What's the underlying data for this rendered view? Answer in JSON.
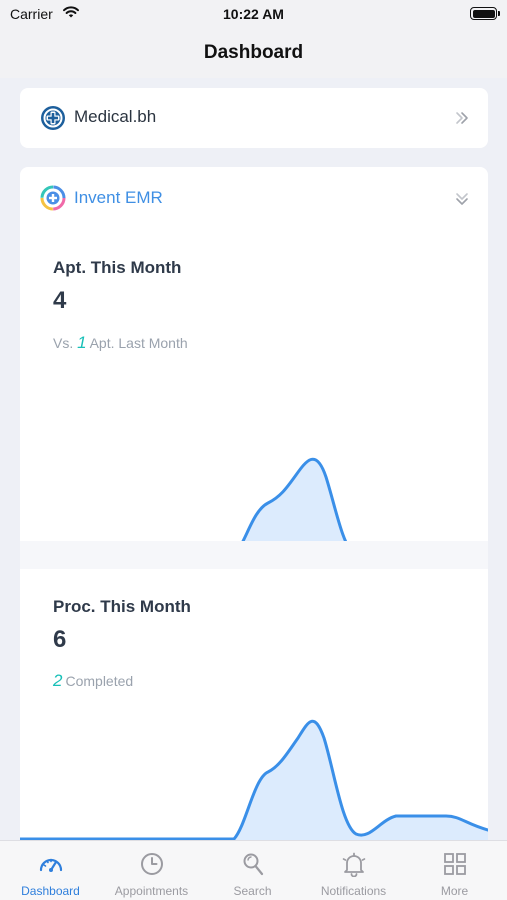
{
  "status_bar": {
    "carrier": "Carrier",
    "time": "10:22 AM"
  },
  "nav": {
    "title": "Dashboard"
  },
  "organizations": [
    {
      "name": "Medical.bh",
      "logo": "medical-logo-icon",
      "chevron": "chevron-right-icon"
    },
    {
      "name": "Invent EMR",
      "logo": "invent-logo-icon",
      "chevron": "chevron-down-icon",
      "accent": "#3f8fe4"
    }
  ],
  "metrics": {
    "appointments": {
      "title": "Apt. This Month",
      "value": "4",
      "compare_value": "1",
      "compare_label": "Vs.",
      "compare_suffix": "Apt. Last Month"
    },
    "procedures": {
      "title": "Proc. This Month",
      "value": "6",
      "completed_value": "2",
      "completed_label": "Completed"
    }
  },
  "tabs": [
    {
      "label": "Dashboard",
      "icon": "speedometer-icon",
      "active": true
    },
    {
      "label": "Appointments",
      "icon": "clock-icon",
      "active": false
    },
    {
      "label": "Search",
      "icon": "search-icon",
      "active": false
    },
    {
      "label": "Notifications",
      "icon": "bell-icon",
      "active": false
    },
    {
      "label": "More",
      "icon": "grid-icon",
      "active": false
    }
  ],
  "colors": {
    "accent": "#2f7fdc",
    "chart_line": "#3a8fe8",
    "chart_fill": "#dcebfd",
    "highlight": "#19c0b8"
  }
}
